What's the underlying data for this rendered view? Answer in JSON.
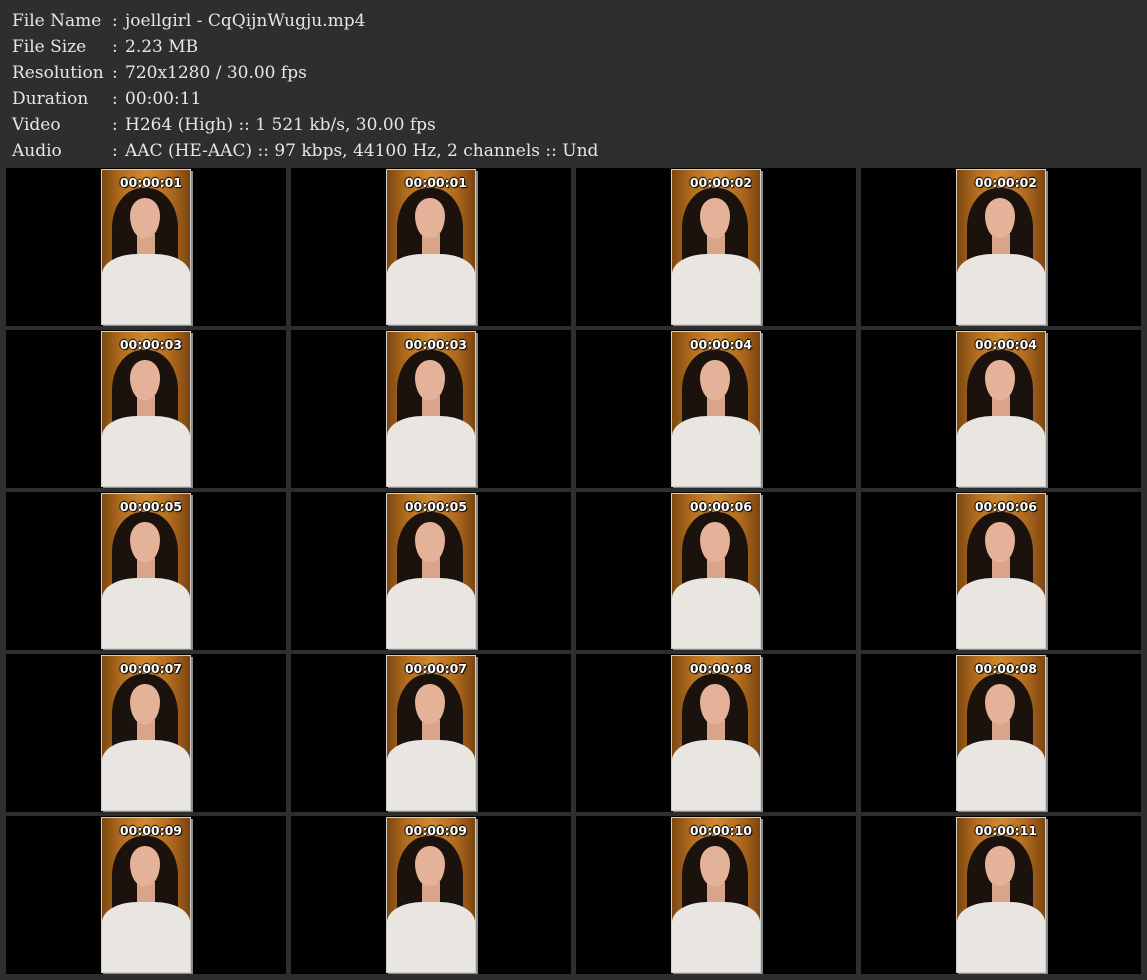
{
  "meta": [
    {
      "key": "File Name",
      "sep": ":",
      "value": "joellgirl - CqQijnWugju.mp4"
    },
    {
      "key": "File Size",
      "sep": ":",
      "value": "2.23 MB"
    },
    {
      "key": "Resolution",
      "sep": ":",
      "value": "720x1280 / 30.00 fps"
    },
    {
      "key": "Duration",
      "sep": ":",
      "value": "00:00:11"
    },
    {
      "key": "Video",
      "sep": ":",
      "value": "H264 (High) :: 1 521 kb/s, 30.00 fps"
    },
    {
      "key": "Audio",
      "sep": ":",
      "value": "AAC (HE-AAC) :: 97 kbps, 44100 Hz, 2 channels :: Und"
    }
  ],
  "thumbs": [
    "00:00:01",
    "00:00:01",
    "00:00:02",
    "00:00:02",
    "00:00:03",
    "00:00:03",
    "00:00:04",
    "00:00:04",
    "00:00:05",
    "00:00:05",
    "00:00:06",
    "00:00:06",
    "00:00:07",
    "00:00:07",
    "00:00:08",
    "00:00:08",
    "00:00:09",
    "00:00:09",
    "00:00:10",
    "00:00:11"
  ]
}
